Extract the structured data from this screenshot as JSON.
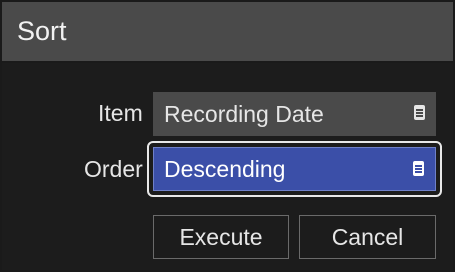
{
  "dialog": {
    "title": "Sort"
  },
  "form": {
    "item": {
      "label": "Item",
      "value": "Recording Date",
      "icon": "menu-icon"
    },
    "order": {
      "label": "Order",
      "value": "Descending",
      "icon": "menu-icon"
    }
  },
  "buttons": {
    "execute_label": "Execute",
    "cancel_label": "Cancel"
  },
  "colors": {
    "titlebar": "#4a4a4a",
    "background": "#1c1c1c",
    "selected_field": "#3b4fa8",
    "focus_outline": "#e8e8e8"
  }
}
